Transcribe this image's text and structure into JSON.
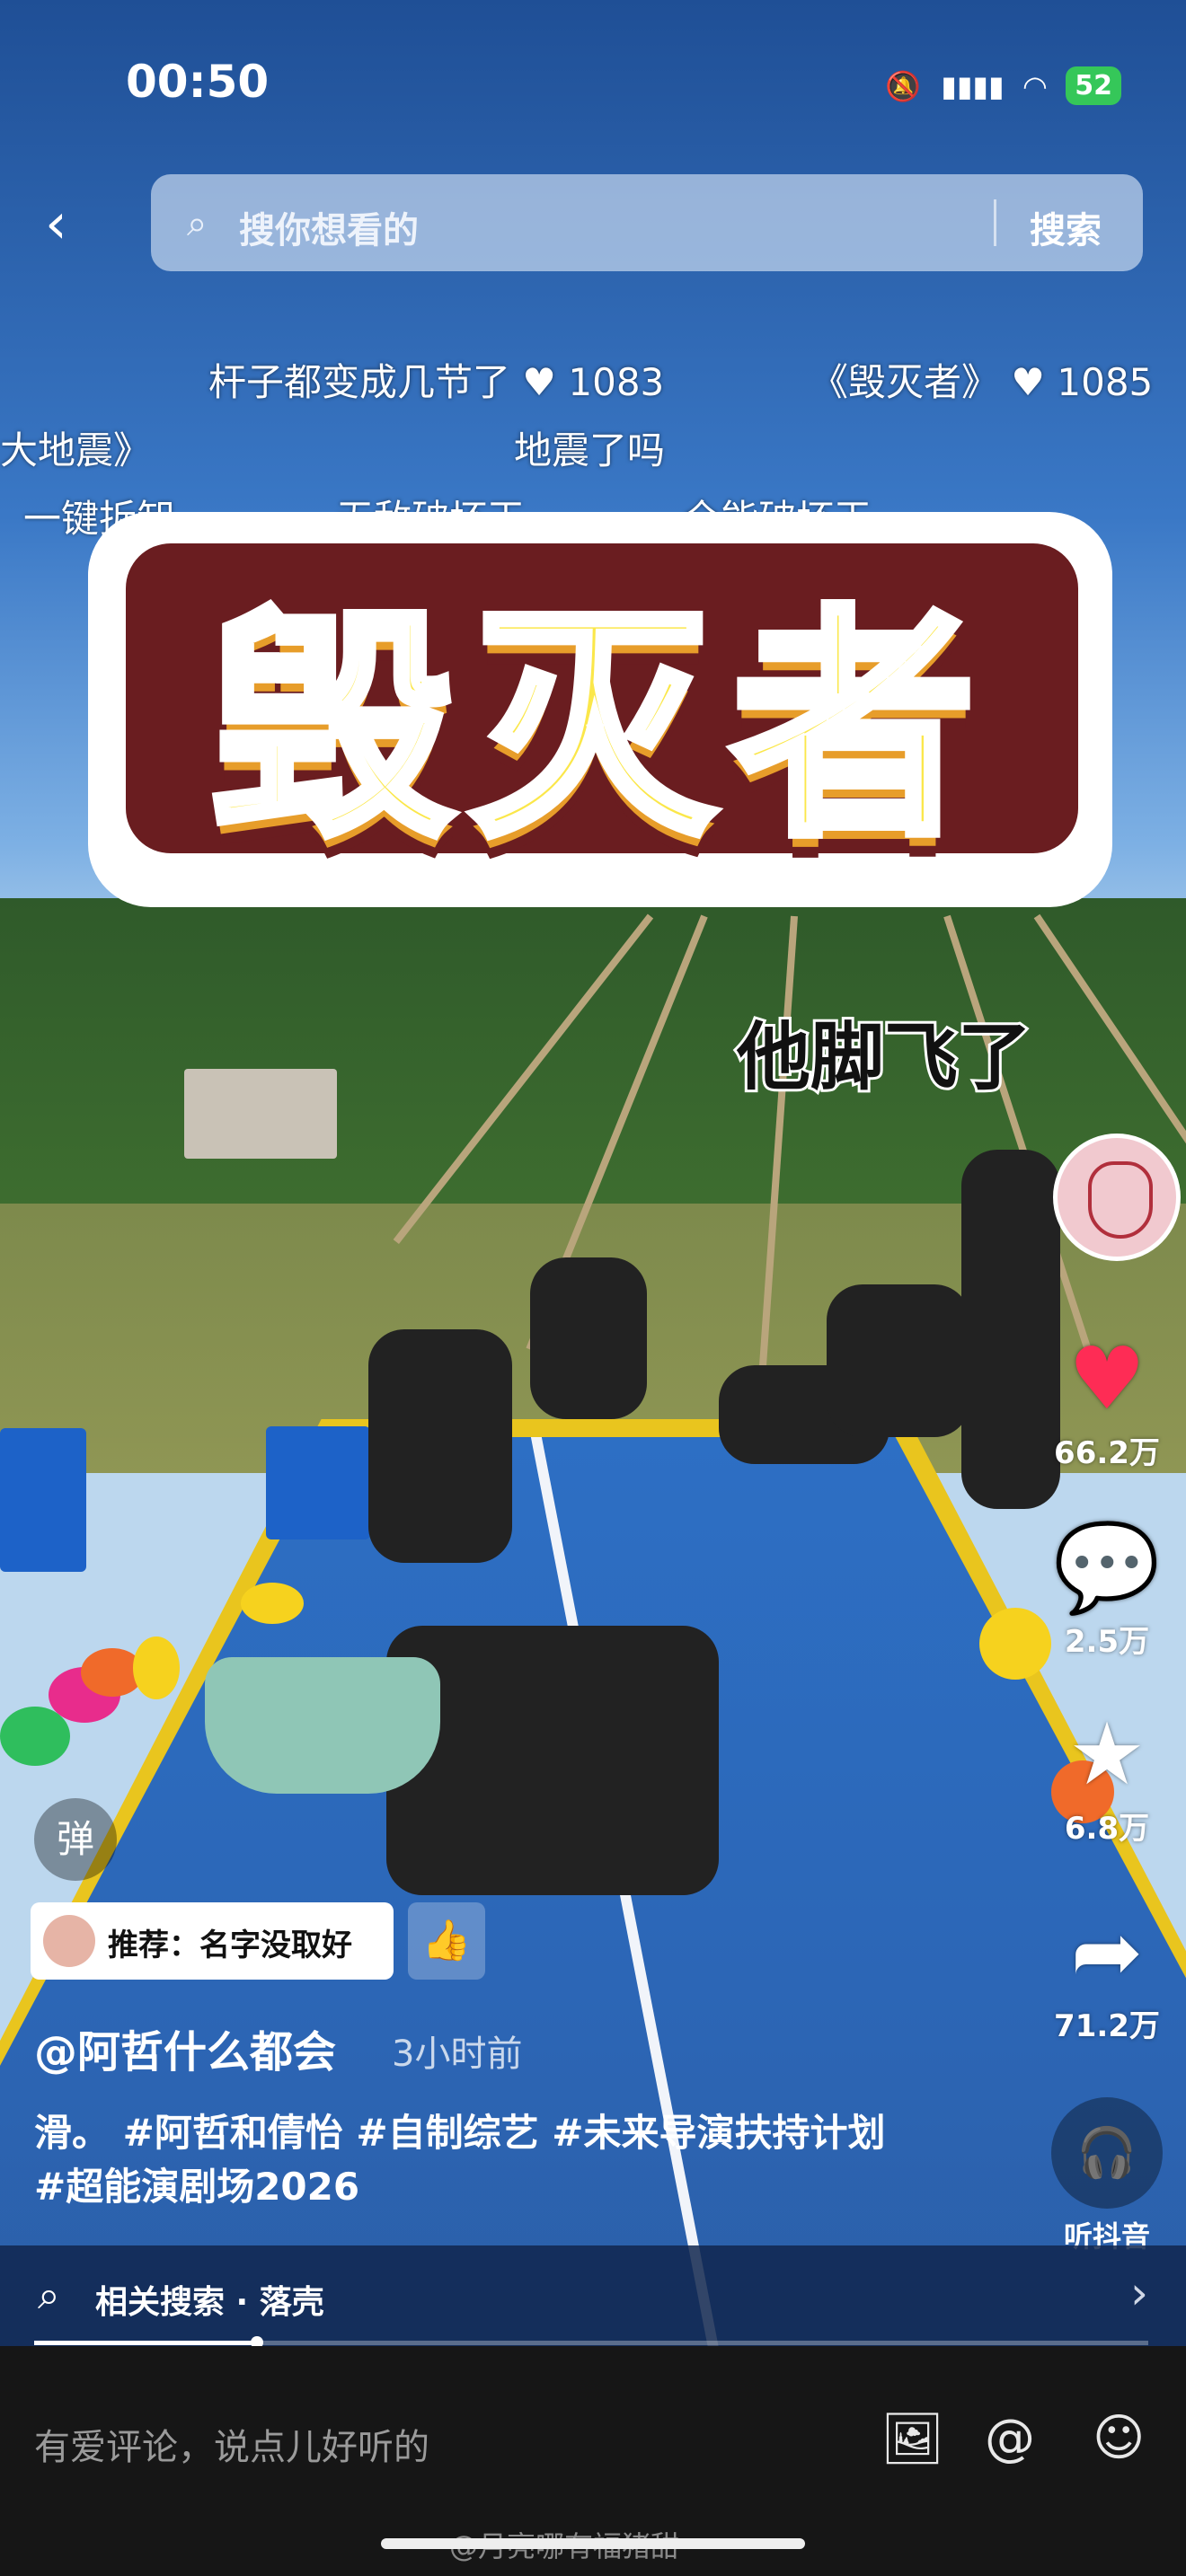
{
  "status_bar": {
    "time": "00:50",
    "silent_icon": "bell-slash-icon",
    "signal_icon": "signal-bars-icon",
    "wifi_icon": "wifi-icon",
    "battery": "52"
  },
  "search": {
    "back_icon": "chevron-left-icon",
    "placeholder": "搜你想看的",
    "button": "搜索"
  },
  "danmaku": [
    {
      "text": "杆子都变成几节了",
      "likes": "1083"
    },
    {
      "text": "《毁灭者》",
      "likes": "1085"
    },
    {
      "text": "大地震》"
    },
    {
      "text": "地震了吗"
    },
    {
      "text": "一键拆卸"
    },
    {
      "text": "无敌破坏王"
    },
    {
      "text": "全能破坏王"
    }
  ],
  "video": {
    "title_overlay": "毁灭者",
    "caption": "他脚飞了"
  },
  "actions": {
    "likes": "66.2万",
    "comments": "2.5万",
    "favorites": "6.8万",
    "shares": "71.2万",
    "listen_label": "听抖音"
  },
  "danmu_toggle": "弹",
  "recommend": {
    "label": "推荐：名字没取好"
  },
  "post": {
    "author": "@阿哲什么都会",
    "time_ago": "3小时前",
    "description_line1": "滑。 #阿哲和倩怡 #自制综艺 #未来导演扶持计划",
    "description_line2": "#超能演剧场2026"
  },
  "related_search": {
    "text": "相关搜索 · 落壳"
  },
  "progress": {
    "fraction": 0.2
  },
  "comment": {
    "placeholder": "有爱评论，说点儿好听的",
    "watermark": "@月亮哪有福猪甜"
  },
  "colors": {
    "like_red": "#fe2c55",
    "title_yellow": "#fbe74a",
    "battery_green": "#35c759"
  }
}
